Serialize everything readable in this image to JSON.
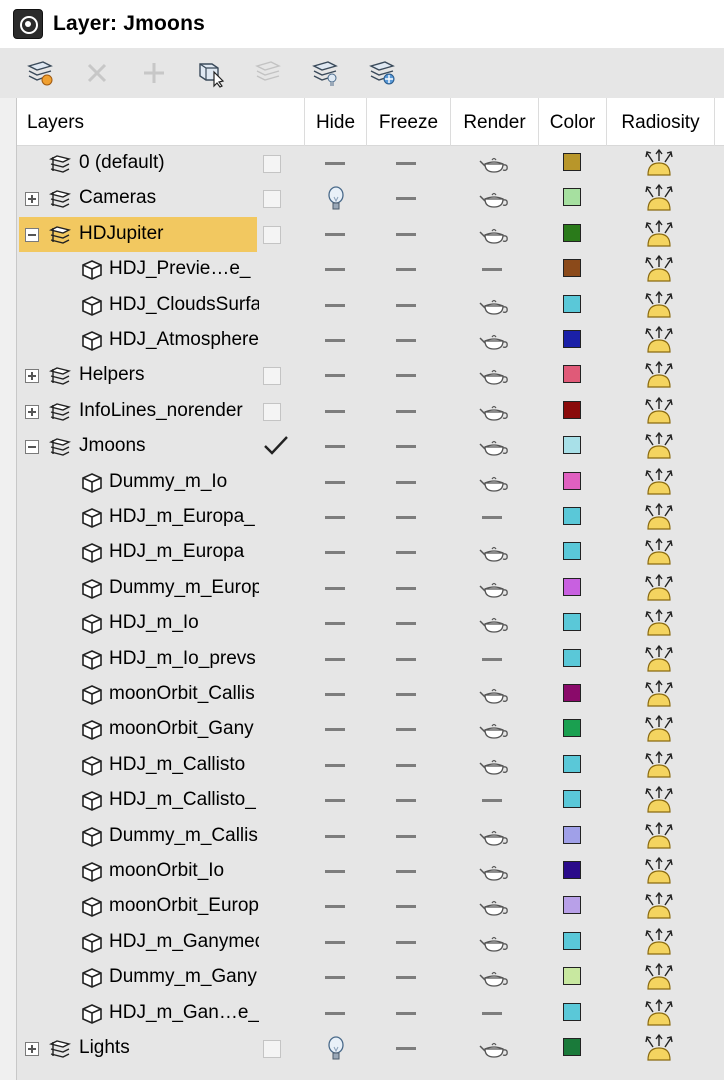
{
  "window": {
    "title": "Layer: Jmoons"
  },
  "toolbar": {
    "buttons": [
      {
        "name": "create-new-layer-icon",
        "enabled": true
      },
      {
        "name": "delete-layer-icon",
        "enabled": false
      },
      {
        "name": "add-to-layer-icon",
        "enabled": false
      },
      {
        "name": "select-objects-in-layer-icon",
        "enabled": true
      },
      {
        "name": "highlight-layer-icon",
        "enabled": false
      },
      {
        "name": "hide-all-layers-icon",
        "enabled": true
      },
      {
        "name": "freeze-all-layers-icon",
        "enabled": true
      }
    ]
  },
  "columns": {
    "layers": "Layers",
    "hide": "Hide",
    "freeze": "Freeze",
    "render": "Render",
    "color": "Color",
    "radiosity": "Radiosity"
  },
  "rows": [
    {
      "type": "layer",
      "level": 0,
      "expander": "none",
      "name": "0 (default)",
      "current": false,
      "selected": false,
      "hidden": false,
      "frozen": false,
      "renderable": true,
      "color": "#b8962a",
      "radiosity": true
    },
    {
      "type": "layer",
      "level": 0,
      "expander": "plus",
      "name": "Cameras",
      "current": false,
      "selected": false,
      "hidden": true,
      "frozen": false,
      "renderable": true,
      "color": "#a6e0a0",
      "radiosity": true
    },
    {
      "type": "layer",
      "level": 0,
      "expander": "minus",
      "name": "HDJupiter",
      "current": false,
      "selected": true,
      "hidden": false,
      "frozen": false,
      "renderable": true,
      "color": "#2a7a1a",
      "radiosity": true
    },
    {
      "type": "object",
      "level": 1,
      "name": "HDJ_Previe…e_",
      "hidden": false,
      "frozen": false,
      "renderable": false,
      "color": "#8b4a1a",
      "radiosity": true
    },
    {
      "type": "object",
      "level": 1,
      "name": "HDJ_CloudsSurfa",
      "hidden": false,
      "frozen": false,
      "renderable": true,
      "color": "#5ac8d8",
      "radiosity": true
    },
    {
      "type": "object",
      "level": 1,
      "name": "HDJ_Atmosphere",
      "hidden": false,
      "frozen": false,
      "renderable": true,
      "color": "#1a20a8",
      "radiosity": true
    },
    {
      "type": "layer",
      "level": 0,
      "expander": "plus",
      "name": "Helpers",
      "current": false,
      "selected": false,
      "hidden": false,
      "frozen": false,
      "renderable": true,
      "color": "#e05a78",
      "radiosity": true
    },
    {
      "type": "layer",
      "level": 0,
      "expander": "plus",
      "name": "InfoLines_norender",
      "current": false,
      "selected": false,
      "hidden": false,
      "frozen": false,
      "renderable": true,
      "color": "#8a0a0a",
      "radiosity": true
    },
    {
      "type": "layer",
      "level": 0,
      "expander": "minus",
      "name": "Jmoons",
      "current": true,
      "selected": false,
      "hidden": false,
      "frozen": false,
      "renderable": true,
      "color": "#a8e0e8",
      "radiosity": true
    },
    {
      "type": "object",
      "level": 1,
      "name": "Dummy_m_Io",
      "hidden": false,
      "frozen": false,
      "renderable": true,
      "color": "#e060c0",
      "radiosity": true
    },
    {
      "type": "object",
      "level": 1,
      "name": "HDJ_m_Europa_",
      "hidden": false,
      "frozen": false,
      "renderable": false,
      "color": "#5ac8d8",
      "radiosity": true
    },
    {
      "type": "object",
      "level": 1,
      "name": "HDJ_m_Europa",
      "hidden": false,
      "frozen": false,
      "renderable": true,
      "color": "#5ac8d8",
      "radiosity": true
    },
    {
      "type": "object",
      "level": 1,
      "name": "Dummy_m_Europ",
      "hidden": false,
      "frozen": false,
      "renderable": true,
      "color": "#c860e0",
      "radiosity": true
    },
    {
      "type": "object",
      "level": 1,
      "name": "HDJ_m_Io",
      "hidden": false,
      "frozen": false,
      "renderable": true,
      "color": "#5ac8d8",
      "radiosity": true
    },
    {
      "type": "object",
      "level": 1,
      "name": "HDJ_m_Io_prevs",
      "hidden": false,
      "frozen": false,
      "renderable": false,
      "color": "#5ac8d8",
      "radiosity": true
    },
    {
      "type": "object",
      "level": 1,
      "name": "moonOrbit_Callis",
      "hidden": false,
      "frozen": false,
      "renderable": true,
      "color": "#8a0a6a",
      "radiosity": true
    },
    {
      "type": "object",
      "level": 1,
      "name": "moonOrbit_Gany",
      "hidden": false,
      "frozen": false,
      "renderable": true,
      "color": "#1aa050",
      "radiosity": true
    },
    {
      "type": "object",
      "level": 1,
      "name": "HDJ_m_Callisto",
      "hidden": false,
      "frozen": false,
      "renderable": true,
      "color": "#5ac8d8",
      "radiosity": true
    },
    {
      "type": "object",
      "level": 1,
      "name": "HDJ_m_Callisto_",
      "hidden": false,
      "frozen": false,
      "renderable": false,
      "color": "#5ac8d8",
      "radiosity": true
    },
    {
      "type": "object",
      "level": 1,
      "name": "Dummy_m_Callis",
      "hidden": false,
      "frozen": false,
      "renderable": true,
      "color": "#a0a0e8",
      "radiosity": true
    },
    {
      "type": "object",
      "level": 1,
      "name": "moonOrbit_Io",
      "hidden": false,
      "frozen": false,
      "renderable": true,
      "color": "#2a0a8a",
      "radiosity": true
    },
    {
      "type": "object",
      "level": 1,
      "name": "moonOrbit_Europ",
      "hidden": false,
      "frozen": false,
      "renderable": true,
      "color": "#b8a0e8",
      "radiosity": true
    },
    {
      "type": "object",
      "level": 1,
      "name": "HDJ_m_Ganymed",
      "hidden": false,
      "frozen": false,
      "renderable": true,
      "color": "#5ac8d8",
      "radiosity": true
    },
    {
      "type": "object",
      "level": 1,
      "name": "Dummy_m_Gany",
      "hidden": false,
      "frozen": false,
      "renderable": true,
      "color": "#c8e8a0",
      "radiosity": true
    },
    {
      "type": "object",
      "level": 1,
      "name": "HDJ_m_Gan…e_",
      "hidden": false,
      "frozen": false,
      "renderable": false,
      "color": "#5ac8d8",
      "radiosity": true
    },
    {
      "type": "layer",
      "level": 0,
      "expander": "plus",
      "name": "Lights",
      "current": false,
      "selected": false,
      "hidden": true,
      "frozen": false,
      "renderable": true,
      "color": "#1a7a3a",
      "radiosity": true
    }
  ]
}
